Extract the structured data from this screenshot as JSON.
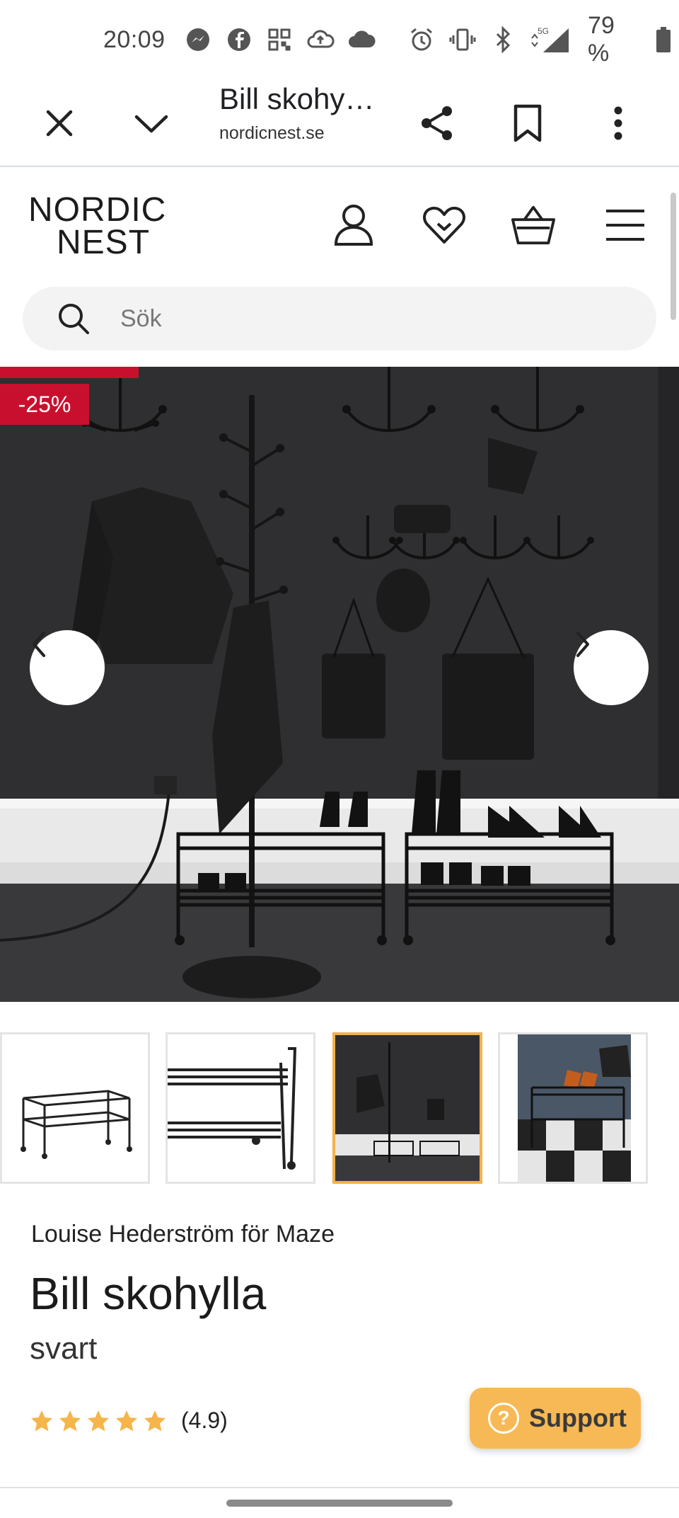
{
  "status_bar": {
    "time": "20:09",
    "battery": "79 %",
    "network": "5G",
    "icons": [
      "messenger-icon",
      "facebook-icon",
      "qr-icon",
      "cloud-upload-icon",
      "cloud-icon",
      "alarm-icon",
      "vibrate-icon",
      "bluetooth-icon",
      "signal-icon",
      "battery-icon"
    ]
  },
  "browser": {
    "title": "Bill skohy…",
    "host": "nordicnest.se",
    "icons": [
      "close-icon",
      "chevron-down-icon",
      "share-icon",
      "bookmark-icon",
      "more-vert-icon"
    ]
  },
  "site": {
    "logo_line1": "NORDIC",
    "logo_line2": "NEST",
    "header_icons": [
      "user-icon",
      "heart-icon",
      "basket-icon",
      "menu-icon"
    ],
    "search_placeholder": "Sök"
  },
  "hero": {
    "discount_badge": "-25%",
    "badge_color": "#c8102e"
  },
  "thumbnails": [
    {
      "name": "thumb-product-angle",
      "selected": false
    },
    {
      "name": "thumb-product-closeup",
      "selected": false
    },
    {
      "name": "thumb-room-dark",
      "selected": true
    },
    {
      "name": "thumb-room-checker",
      "selected": false
    }
  ],
  "product": {
    "designer": "Louise Hederström",
    "for_word": "för",
    "brand": "Maze",
    "title": "Bill skohylla",
    "variant": "svart",
    "rating_value": 4.9,
    "rating_text": "(4.9)",
    "stars": 5
  },
  "support": {
    "label": "Support",
    "color": "#f7b955"
  }
}
